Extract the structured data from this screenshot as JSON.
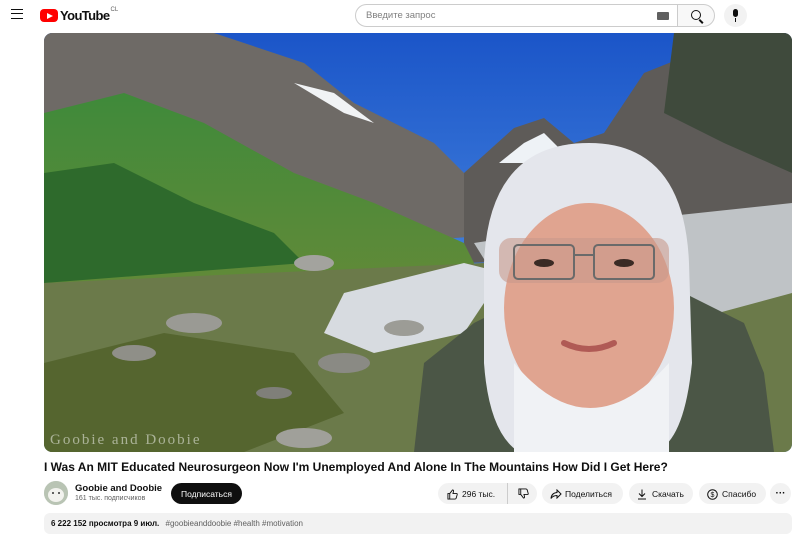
{
  "header": {
    "logo_text": "YouTube",
    "country_code": "CL",
    "search_placeholder": "Введите запрос"
  },
  "video": {
    "watermark": "Goobie and Doobie",
    "title": "I Was An MIT Educated Neurosurgeon Now I'm Unemployed And Alone In The Mountains How Did I Get Here?"
  },
  "channel": {
    "name": "Goobie and Doobie",
    "subscribers": "161 тыс. подписчиков",
    "subscribe_label": "Подписаться"
  },
  "actions": {
    "likes": "296 тыс.",
    "share": "Поделиться",
    "download": "Скачать",
    "thanks": "Спасибо",
    "more": "···"
  },
  "description": {
    "views": "6 222 152 просмотра",
    "date": "9 июл.",
    "tags": "#goobieanddoobie #health #motivation"
  },
  "colors": {
    "brand": "#ff0000",
    "subscribe_bg": "#0f0f0f",
    "pill_bg": "#f2f2f2"
  }
}
